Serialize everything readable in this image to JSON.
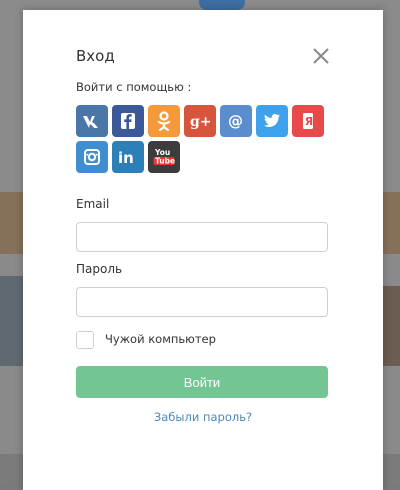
{
  "modal": {
    "title": "Вход",
    "social_label": "Войти с помощью :",
    "social_buttons": [
      {
        "name": "vk",
        "label": "vk",
        "color": "#4a76a8",
        "icon": "vk-icon"
      },
      {
        "name": "facebook",
        "label": "f",
        "color": "#3b5998",
        "icon": "facebook-icon"
      },
      {
        "name": "odnoklassniki",
        "label": "ok",
        "color": "#f59a3b",
        "icon": "odnoklassniki-icon"
      },
      {
        "name": "google-plus",
        "label": "g+",
        "color": "#d6553d",
        "icon": "google-plus-icon"
      },
      {
        "name": "mail",
        "label": "@",
        "color": "#5b8ccd",
        "icon": "mail-icon"
      },
      {
        "name": "twitter",
        "label": "tw",
        "color": "#3ea1ec",
        "icon": "twitter-icon"
      },
      {
        "name": "yandex",
        "label": "я",
        "color": "#e64a4a",
        "icon": "yandex-icon"
      },
      {
        "name": "instagram",
        "label": "ig",
        "color": "#3f8fd0",
        "icon": "instagram-icon"
      },
      {
        "name": "linkedin",
        "label": "in",
        "color": "#2d7fb7",
        "icon": "linkedin-icon"
      },
      {
        "name": "youtube",
        "label": "You Tube",
        "color": "#3c3c3c",
        "icon": "youtube-icon"
      }
    ],
    "email_label": "Email",
    "email_value": "",
    "password_label": "Пароль",
    "password_value": "",
    "remember_label": "Чужой компьютер",
    "submit_label": "Войти",
    "forgot_label": "Забыли пароль?"
  },
  "colors": {
    "submit": "#73c693",
    "link": "#4d87b6",
    "overlay": "#7b7b7b"
  }
}
